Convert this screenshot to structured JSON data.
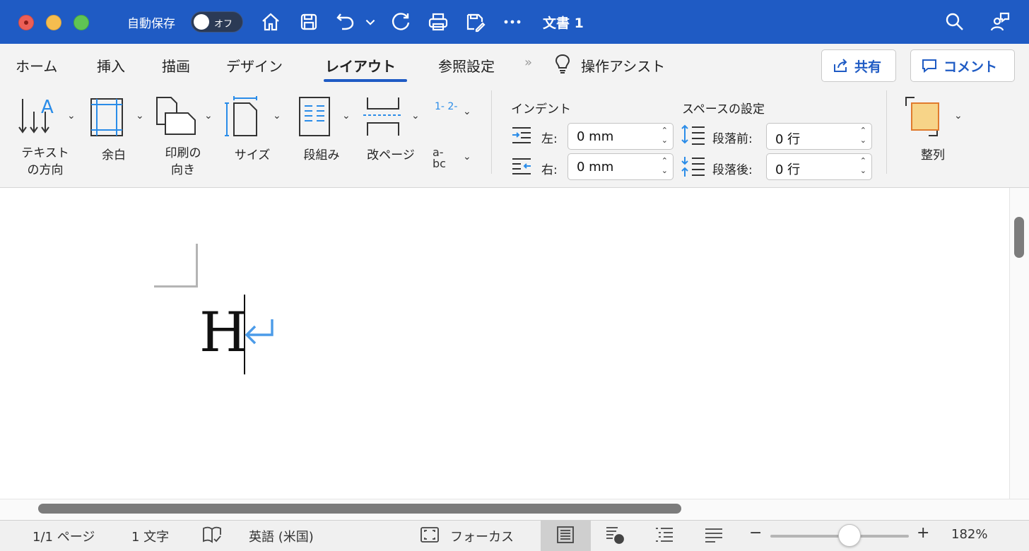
{
  "titlebar": {
    "autosave_label": "自動保存",
    "autosave_state": "オフ",
    "document_title": "文書 1",
    "icons": [
      "home-icon",
      "save-icon",
      "undo-icon",
      "chevron-down-icon",
      "redo-icon",
      "print-icon",
      "save-as-icon",
      "more-icon",
      "search-icon",
      "share-feedback-icon"
    ]
  },
  "tabs": {
    "items": [
      "ホーム",
      "挿入",
      "描画",
      "デザイン",
      "レイアウト",
      "参照設定"
    ],
    "active": "レイアウト",
    "more": "»",
    "assist": "操作アシスト",
    "share_label": "共有",
    "comment_label": "コメント"
  },
  "ribbon": {
    "text_direction": [
      "テキスト",
      "の方向"
    ],
    "margins": "余白",
    "orientation": [
      "印刷の",
      "向き"
    ],
    "size": "サイズ",
    "columns": "段組み",
    "breaks": "改ページ",
    "line_numbers": "1- 2-",
    "hyphenation": "a- bc",
    "indent_title": "インデント",
    "indent_left_label": "左:",
    "indent_left_value": "0 mm",
    "indent_right_label": "右:",
    "indent_right_value": "0 mm",
    "spacing_title": "スペースの設定",
    "spacing_before_label": "段落前:",
    "spacing_before_value": "0 行",
    "spacing_after_label": "段落後:",
    "spacing_after_value": "0 行",
    "arrange": "整列"
  },
  "document": {
    "text": "H"
  },
  "statusbar": {
    "page": "1/1 ページ",
    "word_count": "1 文字",
    "language": "英語 (米国)",
    "focus": "フォーカス",
    "zoom_minus": "−",
    "zoom_plus": "+",
    "zoom": "182%",
    "zoom_level_percent": 182
  },
  "colors": {
    "titlebar": "#1f5bc4",
    "accent": "#1f5bc4",
    "paragraph_mark": "#4b9be8",
    "arrange_fill": "#f7d488"
  }
}
